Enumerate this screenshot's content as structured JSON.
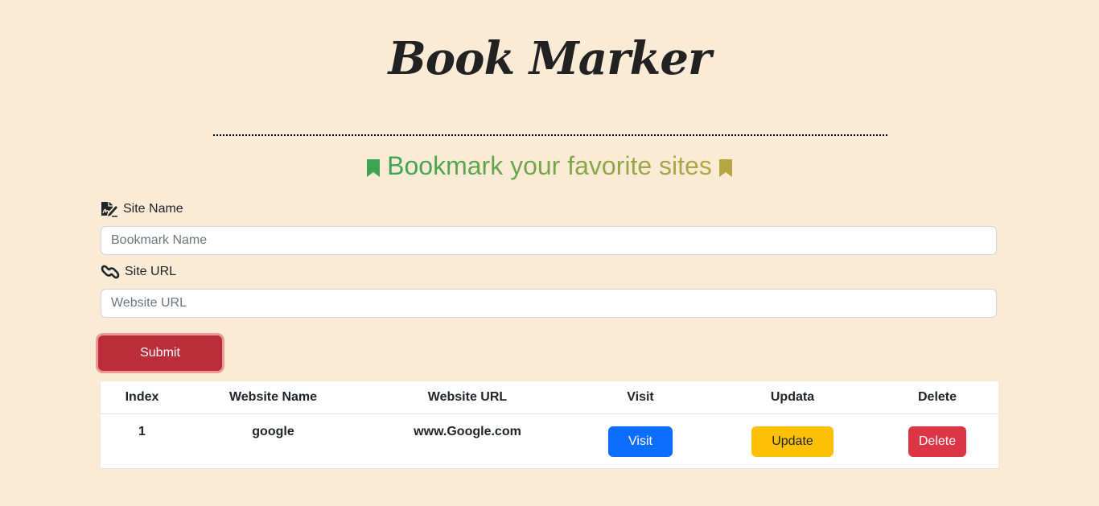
{
  "header": {
    "title": "Book Marker",
    "subtitle": "Bookmark your favorite sites"
  },
  "form": {
    "site_name_label": "Site Name",
    "site_name_placeholder": "Bookmark Name",
    "site_name_value": "",
    "site_url_label": "Site URL",
    "site_url_placeholder": "Website URL",
    "site_url_value": "",
    "submit_label": "Submit"
  },
  "table": {
    "headers": [
      "Index",
      "Website Name",
      "Website URL",
      "Visit",
      "Updata",
      "Delete"
    ],
    "rows": [
      {
        "index": "1",
        "name": "google",
        "url": "www.Google.com",
        "visit_label": "Visit",
        "update_label": "Update",
        "delete_label": "Delete"
      }
    ]
  },
  "colors": {
    "background": "#faebd7",
    "accent_green": "#3ea453",
    "accent_olive": "#b5a642",
    "submit": "#bb2d3b",
    "visit": "#0d6efd",
    "update": "#ffc107",
    "delete": "#dc3545"
  },
  "icons": [
    "bookmark-icon",
    "signature-icon",
    "link-icon"
  ]
}
